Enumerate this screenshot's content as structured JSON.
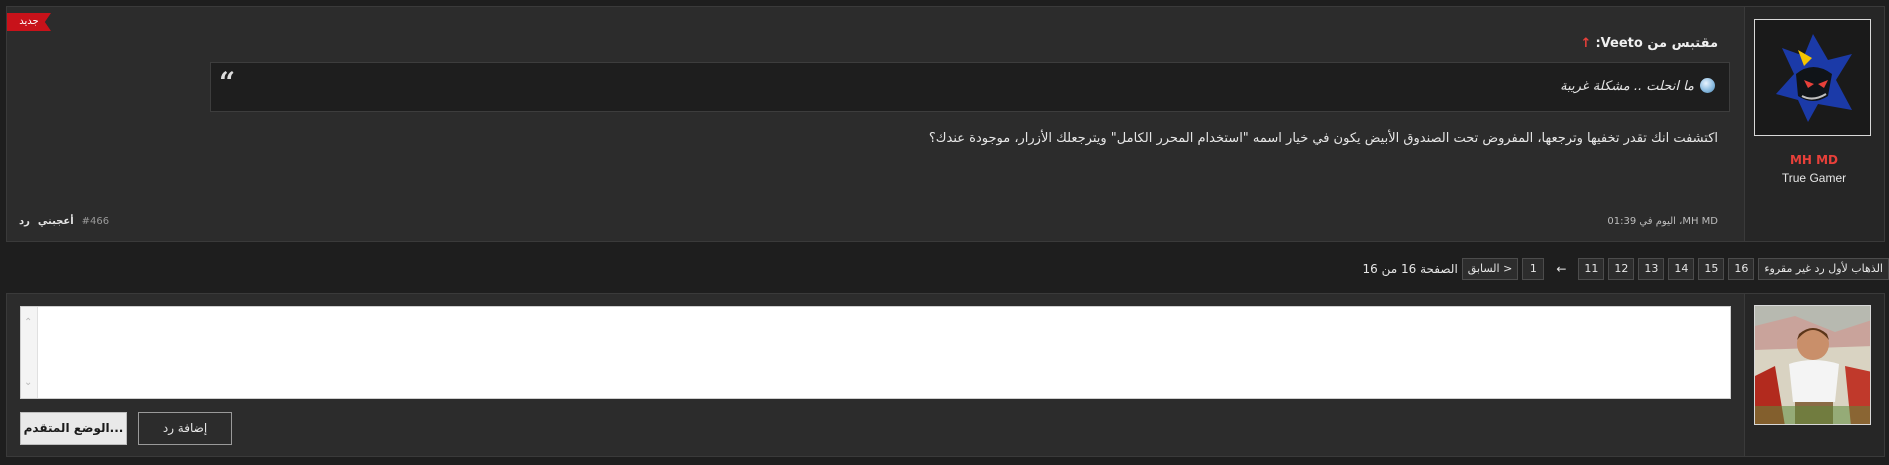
{
  "post": {
    "new_badge": "جديد",
    "username": "MH MD",
    "user_title": "True Gamer",
    "quote_header": "مقتبس من Veeto:",
    "quote_text": "ما انحلت .. مشكلة غريبة",
    "body": "اكتشفت انك تقدر تخفيها وترجعها، المفروض تحت الصندوق الأبيض يكون في خيار اسمه \"استخدام المحرر الكامل\" ويترجعلك الأزرار، موجودة عندك؟",
    "meta": "MH MD، اليوم في 01:39",
    "number": "#466",
    "like_label": "أعجبني",
    "reply_label": "رد"
  },
  "pagination": {
    "label": "الصفحة 16 من 16",
    "prev_label": "< السابق",
    "pages": [
      "1",
      "11",
      "12",
      "13",
      "14",
      "15",
      "16"
    ],
    "ellipsis": "←",
    "unread_label": "الذهاب لأول رد غير مقروء"
  },
  "reply_form": {
    "editor_value": "",
    "advanced_button": "الوضع المتقدم...",
    "add_reply_button": "إضافة رد"
  },
  "colors": {
    "accent_red": "#e8403a",
    "badge_red": "#c8121a",
    "background": "#1e1e1e",
    "panel": "#2c2c2c"
  }
}
